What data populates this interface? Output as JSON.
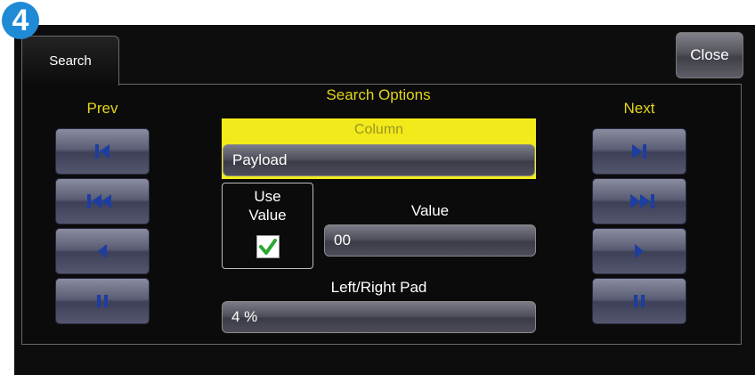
{
  "step_badge": "4",
  "tab": {
    "label": "Search"
  },
  "close_button": {
    "label": "Close"
  },
  "title": "Search Options",
  "prev": {
    "label": "Prev",
    "buttons": [
      "first-icon",
      "skip-back-icon",
      "step-back-icon",
      "pause-icon"
    ]
  },
  "next": {
    "label": "Next",
    "buttons": [
      "last-icon",
      "skip-forward-icon",
      "step-forward-icon",
      "pause-icon"
    ]
  },
  "column": {
    "label": "Column",
    "value": "Payload"
  },
  "use_value": {
    "label_line1": "Use",
    "label_line2": "Value",
    "checked": true
  },
  "value_field": {
    "label": "Value",
    "value": "00"
  },
  "pad": {
    "label": "Left/Right Pad",
    "value": "4 %"
  },
  "colors": {
    "accent_yellow": "#f2ea1a",
    "label_yellow": "#e3d51a",
    "icon_blue": "#1c3ea0",
    "badge_blue": "#1f8ad6",
    "check_green": "#2aa836"
  }
}
